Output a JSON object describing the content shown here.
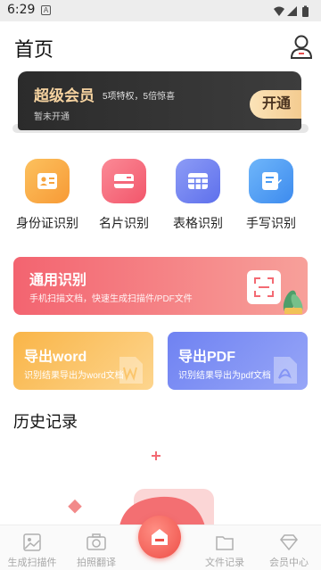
{
  "status_bar": {
    "time": "6:29",
    "notif_letter": "A"
  },
  "header": {
    "title": "首页"
  },
  "vip_banner": {
    "title": "超级会员",
    "desc": "5项特权，5倍惊喜",
    "sub": "暂未开通",
    "button_label": "开通"
  },
  "features": [
    {
      "label": "身份证识别",
      "icon": "id-card-icon",
      "color": "#f9b04a"
    },
    {
      "label": "名片识别",
      "icon": "business-card-icon",
      "color": "#f6687a"
    },
    {
      "label": "表格识别",
      "icon": "table-icon",
      "color": "#6b7ff0"
    },
    {
      "label": "手写识别",
      "icon": "handwriting-icon",
      "color": "#4a9bf3"
    }
  ],
  "general_card": {
    "title": "通用识别",
    "desc": "手机扫描文档，快速生成扫描件/PDF文件"
  },
  "export_word": {
    "title": "导出word",
    "desc": "识别结果导出为word文档"
  },
  "export_pdf": {
    "title": "导出PDF",
    "desc": "识别结果导出为pdf文档"
  },
  "history": {
    "title": "历史记录"
  },
  "bottom_nav": [
    {
      "label": "生成扫描件",
      "icon": "image-icon"
    },
    {
      "label": "拍照翻译",
      "icon": "camera-icon"
    },
    {
      "label": "",
      "icon": "home-icon"
    },
    {
      "label": "文件记录",
      "icon": "folder-icon"
    },
    {
      "label": "会员中心",
      "icon": "diamond-icon"
    }
  ]
}
